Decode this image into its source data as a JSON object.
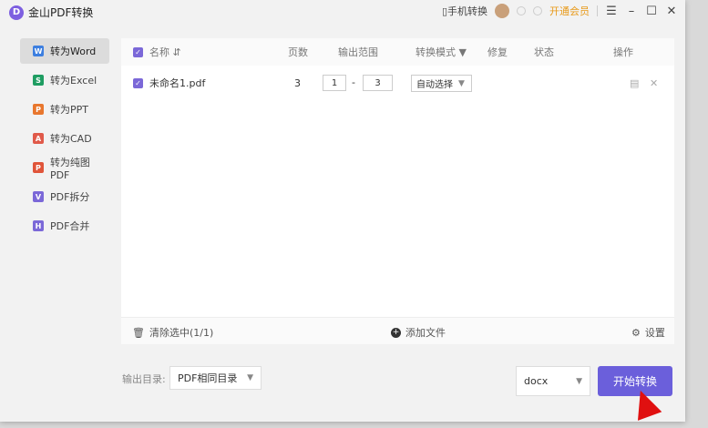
{
  "app": {
    "title": "金山PDF转换",
    "logo": "D"
  },
  "titlebar": {
    "mobile": "手机转换",
    "vip": "开通会员"
  },
  "sidebar": {
    "items": [
      {
        "label": "转为Word",
        "icon": "W",
        "color": "#3d7fe0"
      },
      {
        "label": "转为Excel",
        "icon": "S",
        "color": "#1f9d62"
      },
      {
        "label": "转为PPT",
        "icon": "P",
        "color": "#e8772e"
      },
      {
        "label": "转为CAD",
        "icon": "A",
        "color": "#e05a4a"
      },
      {
        "label": "转为纯图PDF",
        "icon": "P",
        "color": "#e0553a"
      },
      {
        "label": "PDF拆分",
        "icon": "V",
        "color": "#7b68d8"
      },
      {
        "label": "PDF合并",
        "icon": "H",
        "color": "#7b68d8"
      }
    ]
  },
  "table": {
    "headers": {
      "name": "名称",
      "pages": "页数",
      "range": "输出范围",
      "mode": "转换模式",
      "repair": "修复",
      "status": "状态",
      "action": "操作"
    },
    "rows": [
      {
        "name": "未命名1.pdf",
        "pages": "3",
        "from": "1",
        "dash": "-",
        "to": "3",
        "mode": "自动选择"
      }
    ]
  },
  "footer": {
    "clear": "清除选中(1/1)",
    "add": "添加文件",
    "settings": "设置"
  },
  "bottom": {
    "output_label": "输出目录:",
    "output_value": "PDF相同目录",
    "format": "docx",
    "start": "开始转换"
  }
}
